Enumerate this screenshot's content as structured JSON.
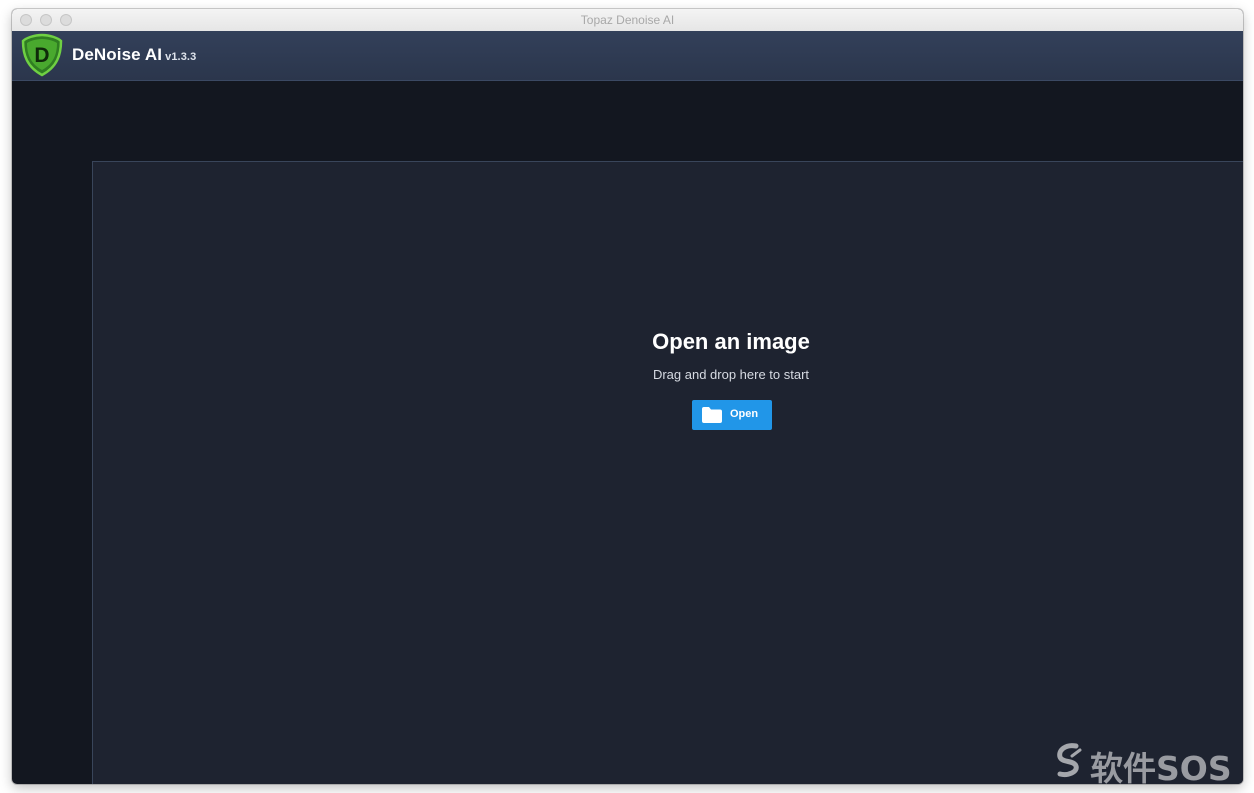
{
  "window": {
    "title": "Topaz Denoise AI"
  },
  "app": {
    "name": "DeNoise AI",
    "version": "v1.3.3",
    "logo_icon": "denoise-d-shield-logo",
    "logo_letter": "D"
  },
  "drop_zone": {
    "title": "Open an image",
    "subtitle": "Drag and drop here to start",
    "open_button_label": "Open",
    "open_button_icon": "folder-icon"
  },
  "watermark": {
    "text": "软件SOS"
  },
  "colors": {
    "accent": "#2196e8",
    "appbar": "#2f3b52",
    "drop_zone_bg": "#1e2330",
    "window_bg": "#131720",
    "logo_green": "#5bc236"
  }
}
